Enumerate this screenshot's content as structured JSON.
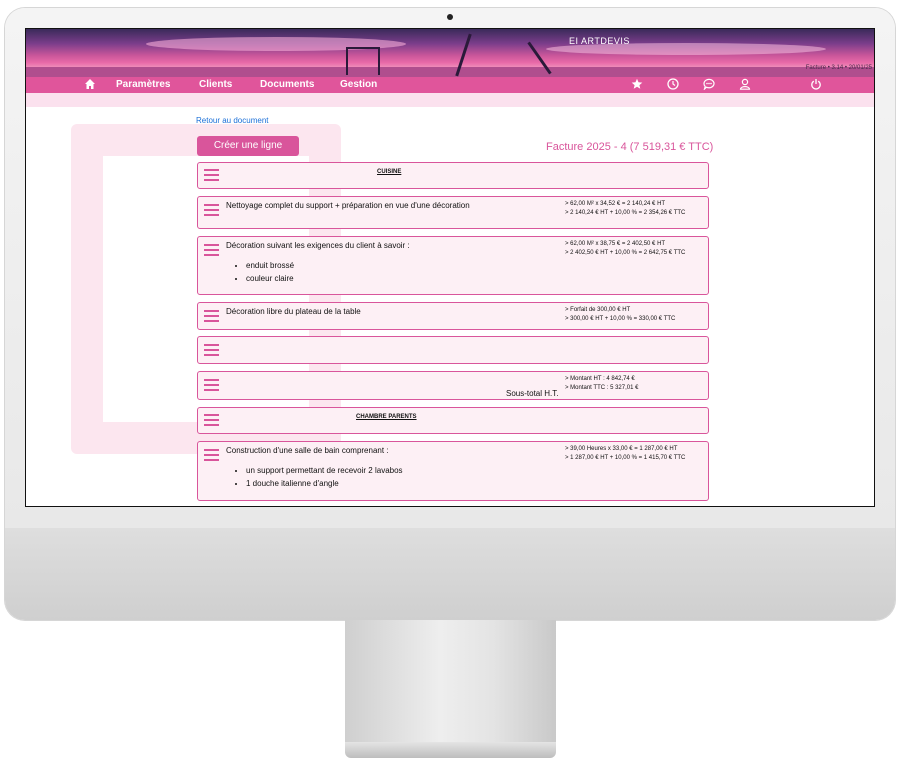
{
  "app": {
    "company": "EI ARTDEVIS",
    "version": "Facture • 3.14 • 20/01/25"
  },
  "nav": {
    "items": [
      "Paramètres",
      "Clients",
      "Documents",
      "Gestion"
    ],
    "icons": [
      "home-icon",
      "star-icon",
      "clock-icon",
      "chat-icon",
      "user-icon",
      "power-icon"
    ]
  },
  "page": {
    "back_link": "Retour au document",
    "create_button": "Créer une ligne",
    "invoice_title": "Facture 2025 - 4 (7 519,31 € TTC)"
  },
  "rows": [
    {
      "type": "section",
      "title": "CUISINE"
    },
    {
      "type": "line",
      "description": "Nettoyage complet du support + préparation en vue d'une décoration",
      "calc": [
        "> 62,00 M² x 34,52 € = 2 140,24 € HT",
        "> 2 140,24 € HT + 10,00 % = 2 354,26 € TTC"
      ]
    },
    {
      "type": "line",
      "description": "Décoration suivant les exigences du client à savoir :",
      "bullets": [
        "enduit brossé",
        "couleur claire"
      ],
      "calc": [
        "> 62,00 M² x 38,75 € = 2 402,50 € HT",
        "> 2 402,50 € HT + 10,00 % = 2 642,75 € TTC"
      ]
    },
    {
      "type": "line",
      "description": "Décoration libre du plateau de la table",
      "calc": [
        "> Forfait de 300,00 € HT",
        "> 300,00 € HT + 10,00 % = 330,00 € TTC"
      ]
    },
    {
      "type": "empty"
    },
    {
      "type": "subtotal",
      "label": "Sous-total H.T.",
      "calc": [
        "> Montant HT : 4 842,74 €",
        "> Montant TTC : 5 327,01 €"
      ]
    },
    {
      "type": "section",
      "title": "CHAMBRE PARENTS"
    },
    {
      "type": "line",
      "description": "Construction d'une salle de bain comprenant :",
      "bullets": [
        "un support permettant de recevoir 2 lavabos",
        "1 douche italienne d'angle"
      ],
      "calc": [
        "> 39,00 Heures x 33,00 € = 1 287,00 € HT",
        "> 1 287,00 € HT + 10,00 % = 1 415,70 € TTC"
      ]
    }
  ]
}
